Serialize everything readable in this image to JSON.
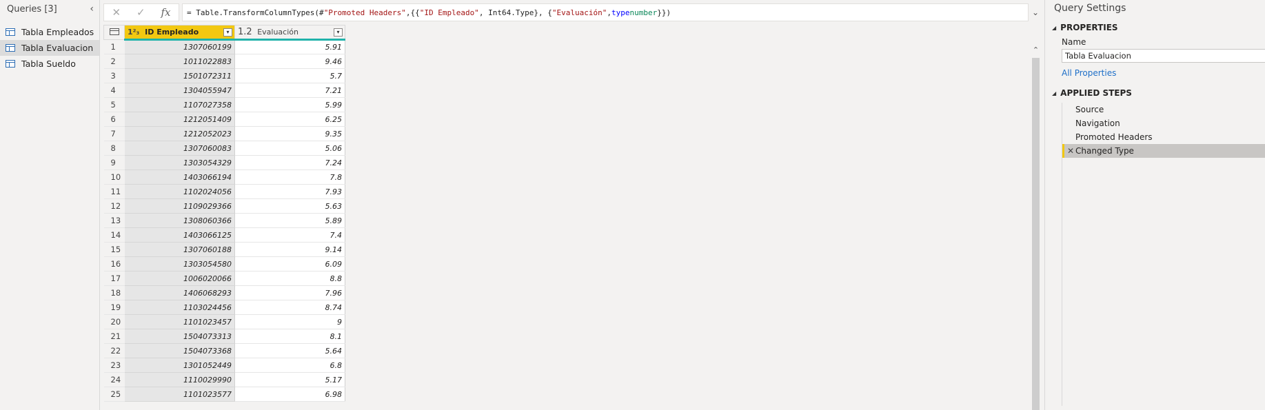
{
  "queries": {
    "title": "Queries [3]",
    "collapse_icon": "‹",
    "items": [
      {
        "label": "Tabla Empleados",
        "selected": false
      },
      {
        "label": "Tabla Evaluacion",
        "selected": true
      },
      {
        "label": "Tabla Sueldo",
        "selected": false
      }
    ]
  },
  "formula": {
    "cancel_icon": "✕",
    "confirm_icon": "✓",
    "fx_label": "fx",
    "prefix": "= Table.TransformColumnTypes(#",
    "s1": "\"Promoted Headers\"",
    "p2": ",{{",
    "s2": "\"ID Empleado\"",
    "p3": ", Int64.Type}, {",
    "s3": "\"Evaluación\"",
    "p4": ", ",
    "kw": "type",
    "p5": " ",
    "ty": "number",
    "p6": "}})",
    "expand_icon": "⌄"
  },
  "grid": {
    "columns": [
      {
        "type_tag": "1²₃",
        "name": "ID Empleado",
        "filter_icon": "▾"
      },
      {
        "type_tag": "1.2",
        "name": "Evaluación",
        "filter_icon": "▾"
      }
    ],
    "rows": [
      {
        "n": "1",
        "id": "1307060199",
        "eval": "5.91"
      },
      {
        "n": "2",
        "id": "1011022883",
        "eval": "9.46"
      },
      {
        "n": "3",
        "id": "1501072311",
        "eval": "5.7"
      },
      {
        "n": "4",
        "id": "1304055947",
        "eval": "7.21"
      },
      {
        "n": "5",
        "id": "1107027358",
        "eval": "5.99"
      },
      {
        "n": "6",
        "id": "1212051409",
        "eval": "6.25"
      },
      {
        "n": "7",
        "id": "1212052023",
        "eval": "9.35"
      },
      {
        "n": "8",
        "id": "1307060083",
        "eval": "5.06"
      },
      {
        "n": "9",
        "id": "1303054329",
        "eval": "7.24"
      },
      {
        "n": "10",
        "id": "1403066194",
        "eval": "7.8"
      },
      {
        "n": "11",
        "id": "1102024056",
        "eval": "7.93"
      },
      {
        "n": "12",
        "id": "1109029366",
        "eval": "5.63"
      },
      {
        "n": "13",
        "id": "1308060366",
        "eval": "5.89"
      },
      {
        "n": "14",
        "id": "1403066125",
        "eval": "7.4"
      },
      {
        "n": "15",
        "id": "1307060188",
        "eval": "9.14"
      },
      {
        "n": "16",
        "id": "1303054580",
        "eval": "6.09"
      },
      {
        "n": "17",
        "id": "1006020066",
        "eval": "8.8"
      },
      {
        "n": "18",
        "id": "1406068293",
        "eval": "7.96"
      },
      {
        "n": "19",
        "id": "1103024456",
        "eval": "8.74"
      },
      {
        "n": "20",
        "id": "1101023457",
        "eval": "9"
      },
      {
        "n": "21",
        "id": "1504073313",
        "eval": "8.1"
      },
      {
        "n": "22",
        "id": "1504073368",
        "eval": "5.64"
      },
      {
        "n": "23",
        "id": "1301052449",
        "eval": "6.8"
      },
      {
        "n": "24",
        "id": "1110029990",
        "eval": "5.17"
      },
      {
        "n": "25",
        "id": "1101023577",
        "eval": "6.98"
      }
    ],
    "scroll_up_icon": "⌃"
  },
  "settings": {
    "title": "Query Settings",
    "properties_header": "PROPERTIES",
    "name_label": "Name",
    "name_value": "Tabla Evaluacion",
    "all_properties": "All Properties",
    "steps_header": "APPLIED STEPS",
    "steps": [
      {
        "label": "Source",
        "selected": false
      },
      {
        "label": "Navigation",
        "selected": false
      },
      {
        "label": "Promoted Headers",
        "selected": false
      },
      {
        "label": "Changed Type",
        "selected": true
      }
    ],
    "delete_icon": "✕",
    "caret_icon": "◢"
  },
  "colors": {
    "accent_yellow": "#f2c811",
    "column_quality_teal": "#20b2aa",
    "link_blue": "#1e6fc8"
  }
}
